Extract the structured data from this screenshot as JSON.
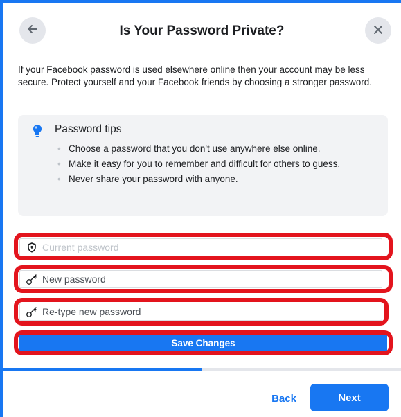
{
  "dialog": {
    "title": "Is Your Password Private?",
    "back_icon": "arrow-left-icon",
    "close_icon": "close-icon",
    "intro": "If your Facebook password is used elsewhere online then your account may be less secure. Protect yourself and your Facebook friends by choosing a stronger password."
  },
  "tips": {
    "icon": "lightbulb-icon",
    "title": "Password tips",
    "items": [
      "Choose a password that you don't use anywhere else online.",
      "Make it easy for you to remember and difficult for others to guess.",
      "Never share your password with anyone."
    ]
  },
  "form": {
    "current_password": {
      "placeholder": "Current password",
      "value": "",
      "icon": "shield-icon"
    },
    "new_password": {
      "placeholder": "New password",
      "value": "",
      "icon": "key-icon"
    },
    "retype_password": {
      "placeholder": "Re-type new password",
      "value": "",
      "icon": "key-icon"
    },
    "save_label": "Save Changes"
  },
  "progress": {
    "fraction": 0.5
  },
  "footer": {
    "back_label": "Back",
    "next_label": "Next"
  },
  "colors": {
    "accent": "#1877f2",
    "highlight": "#e3141d",
    "tips_background": "#f2f3f5"
  }
}
